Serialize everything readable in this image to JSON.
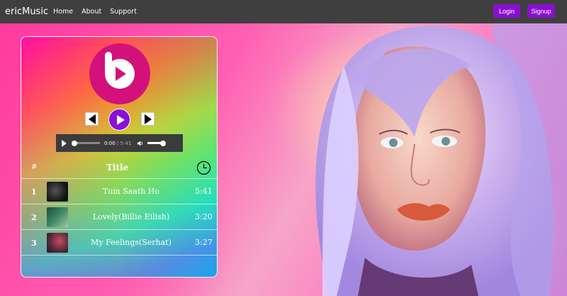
{
  "nav": {
    "brand": "ericMusic",
    "links": [
      "Home",
      "About",
      "Support"
    ],
    "login_label": "Login",
    "signup_label": "Signup"
  },
  "player": {
    "audio": {
      "current": "0:00",
      "separator": " / ",
      "duration": "5:41"
    }
  },
  "table": {
    "headers": {
      "num": "#",
      "title": "Title"
    },
    "rows": [
      {
        "num": "1",
        "title": "Tum Saath Ho",
        "duration": "5:41"
      },
      {
        "num": "2",
        "title": "Lovely(Billie Eilish)",
        "duration": "3:20"
      },
      {
        "num": "3",
        "title": "My Feelings(Serhat)",
        "duration": "3:27"
      }
    ]
  },
  "colors": {
    "accent": "#8a0fd0",
    "navbar": "#3f3f3f",
    "logo": "#d3117a"
  }
}
